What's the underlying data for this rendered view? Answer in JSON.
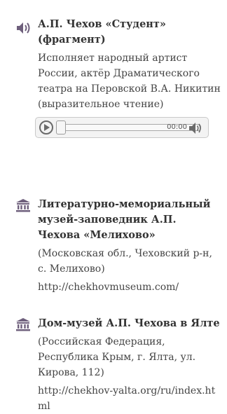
{
  "items": [
    {
      "icon": "speaker-icon",
      "title": "А.П. Чехов «Студент» (фрагмент)",
      "description": "Исполняет народный артист России, актёр Драматического театра на Перовской В.А. Никитин (выразительное чтение)"
    },
    {
      "icon": "museum-icon",
      "title": "Литературно-мемориальный музей-заповедник А.П. Чехова «Мелихово»",
      "address": "(Московская обл., Чеховский р-н, с. Мелихово)",
      "link": "http://chekhovmuseum.com/"
    },
    {
      "icon": "museum-icon",
      "title": "Дом-музей А.П. Чехова в Ялте",
      "address": "(Российская Федерация, Республика Крым, г. Ялта, ул. Кирова, 112)",
      "link": "http://chekhov-yalta.org/ru/index.html"
    }
  ],
  "player": {
    "time": "00:00",
    "progress": 0
  },
  "colors": {
    "icon": "#6e5f7c",
    "text": "#444444"
  }
}
